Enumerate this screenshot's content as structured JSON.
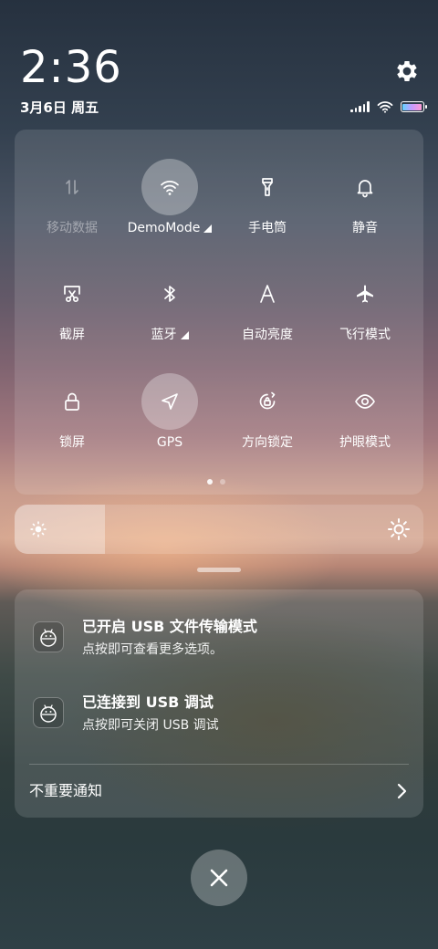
{
  "header": {
    "time": "2:36",
    "date": "3月6日 周五"
  },
  "status": {
    "battery_level": 1.0,
    "signal_bars": 4
  },
  "quick_settings": {
    "tiles": [
      {
        "label": "移动数据",
        "icon": "mobile-data-icon",
        "active": false,
        "disabled": true
      },
      {
        "label": "DemoMode",
        "icon": "wifi-icon",
        "active": true,
        "has_submenu": true
      },
      {
        "label": "手电筒",
        "icon": "flashlight-icon",
        "active": false
      },
      {
        "label": "静音",
        "icon": "bell-icon",
        "active": false
      },
      {
        "label": "截屏",
        "icon": "screenshot-icon",
        "active": false
      },
      {
        "label": "蓝牙",
        "icon": "bluetooth-icon",
        "active": false,
        "has_submenu": true
      },
      {
        "label": "自动亮度",
        "icon": "auto-brightness-icon",
        "active": false
      },
      {
        "label": "飞行模式",
        "icon": "airplane-icon",
        "active": false
      },
      {
        "label": "锁屏",
        "icon": "lock-icon",
        "active": false
      },
      {
        "label": "GPS",
        "icon": "gps-icon",
        "active": true
      },
      {
        "label": "方向锁定",
        "icon": "rotation-lock-icon",
        "active": false
      },
      {
        "label": "护眼模式",
        "icon": "eye-icon",
        "active": false
      }
    ],
    "page_count": 2,
    "current_page": 1
  },
  "brightness": {
    "level": 0.22
  },
  "notifications": [
    {
      "title": "已开启 USB 文件传输模式",
      "body": "点按即可查看更多选项。",
      "icon": "android-icon"
    },
    {
      "title": "已连接到 USB 调试",
      "body": "点按即可关闭 USB 调试",
      "icon": "android-icon"
    }
  ],
  "minor_notifications": {
    "label": "不重要通知"
  },
  "colors": {
    "active_tile_bg": "#ffffff4d",
    "panel_bg": "#ffffff1f"
  }
}
